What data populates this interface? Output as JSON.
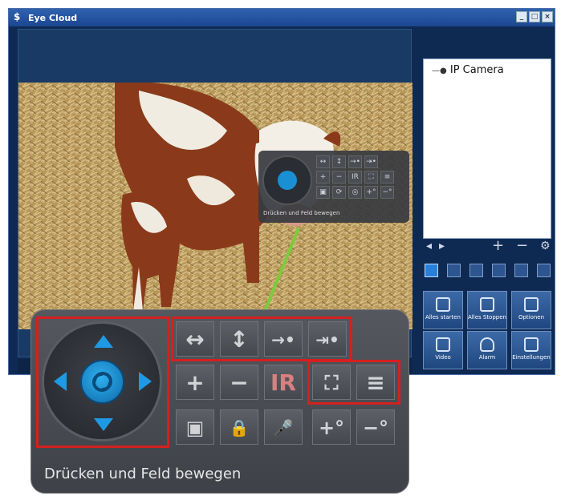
{
  "window": {
    "title": "Eye Cloud",
    "logo_glyph": "$",
    "controls": {
      "minimize": "_",
      "restore": "□",
      "close": "×"
    }
  },
  "device_tree": {
    "items": [
      {
        "label": "IP Camera",
        "icon": "camera-icon"
      }
    ]
  },
  "camera_nav": {
    "prev": "◂",
    "next": "▸",
    "add": "+",
    "remove": "−",
    "settings": "⚙"
  },
  "layout_buttons": [
    "1-view",
    "4-view",
    "9-view",
    "16-view",
    "full-view",
    "custom-view"
  ],
  "actions": [
    {
      "label": "Alles starten",
      "icon": "play-all-icon"
    },
    {
      "label": "Alles Stoppen",
      "icon": "stop-all-icon"
    },
    {
      "label": "Optionen",
      "icon": "options-icon"
    },
    {
      "label": "Video",
      "icon": "video-icon"
    },
    {
      "label": "Alarm",
      "icon": "bell-icon"
    },
    {
      "label": "Einstellungen",
      "icon": "wrench-icon"
    }
  ],
  "mini_ptz": {
    "caption": "Drücken und Feld bewegen",
    "tiles": [
      "↔",
      "↕",
      "→•",
      "⇥•",
      "+",
      "−",
      "IR",
      "⛶",
      "≡",
      "▣",
      "⟳",
      "◎",
      "+°",
      "−°"
    ]
  },
  "ptz_panel": {
    "caption": "Drücken und Feld bewegen",
    "row1": [
      {
        "glyph": "↔",
        "icon": "pan-horizontal-icon"
      },
      {
        "glyph": "↕",
        "icon": "pan-vertical-icon"
      },
      {
        "glyph": "→•",
        "icon": "goto-preset-icon"
      },
      {
        "glyph": "⇥•",
        "icon": "set-preset-icon"
      }
    ],
    "row2": [
      {
        "glyph": "+",
        "icon": "zoom-in-icon"
      },
      {
        "glyph": "−",
        "icon": "zoom-out-icon"
      },
      {
        "glyph": "IR",
        "icon": "ir-icon"
      },
      {
        "glyph": "⛶",
        "icon": "fullscreen-icon"
      },
      {
        "glyph": "≡",
        "icon": "speed-icon"
      }
    ],
    "row3": [
      {
        "glyph": "▣",
        "icon": "image-settings-icon"
      },
      {
        "glyph": "🔒",
        "icon": "lock-record-icon"
      },
      {
        "glyph": "🎤",
        "icon": "mic-lock-icon"
      },
      {
        "glyph": "+°",
        "icon": "brightness-up-icon"
      },
      {
        "glyph": "−°",
        "icon": "brightness-down-icon"
      }
    ]
  },
  "colors": {
    "window_bg": "#0f2a52",
    "accent": "#1e9ae4",
    "highlight": "#d42020",
    "connector": "#7ccb3c"
  }
}
